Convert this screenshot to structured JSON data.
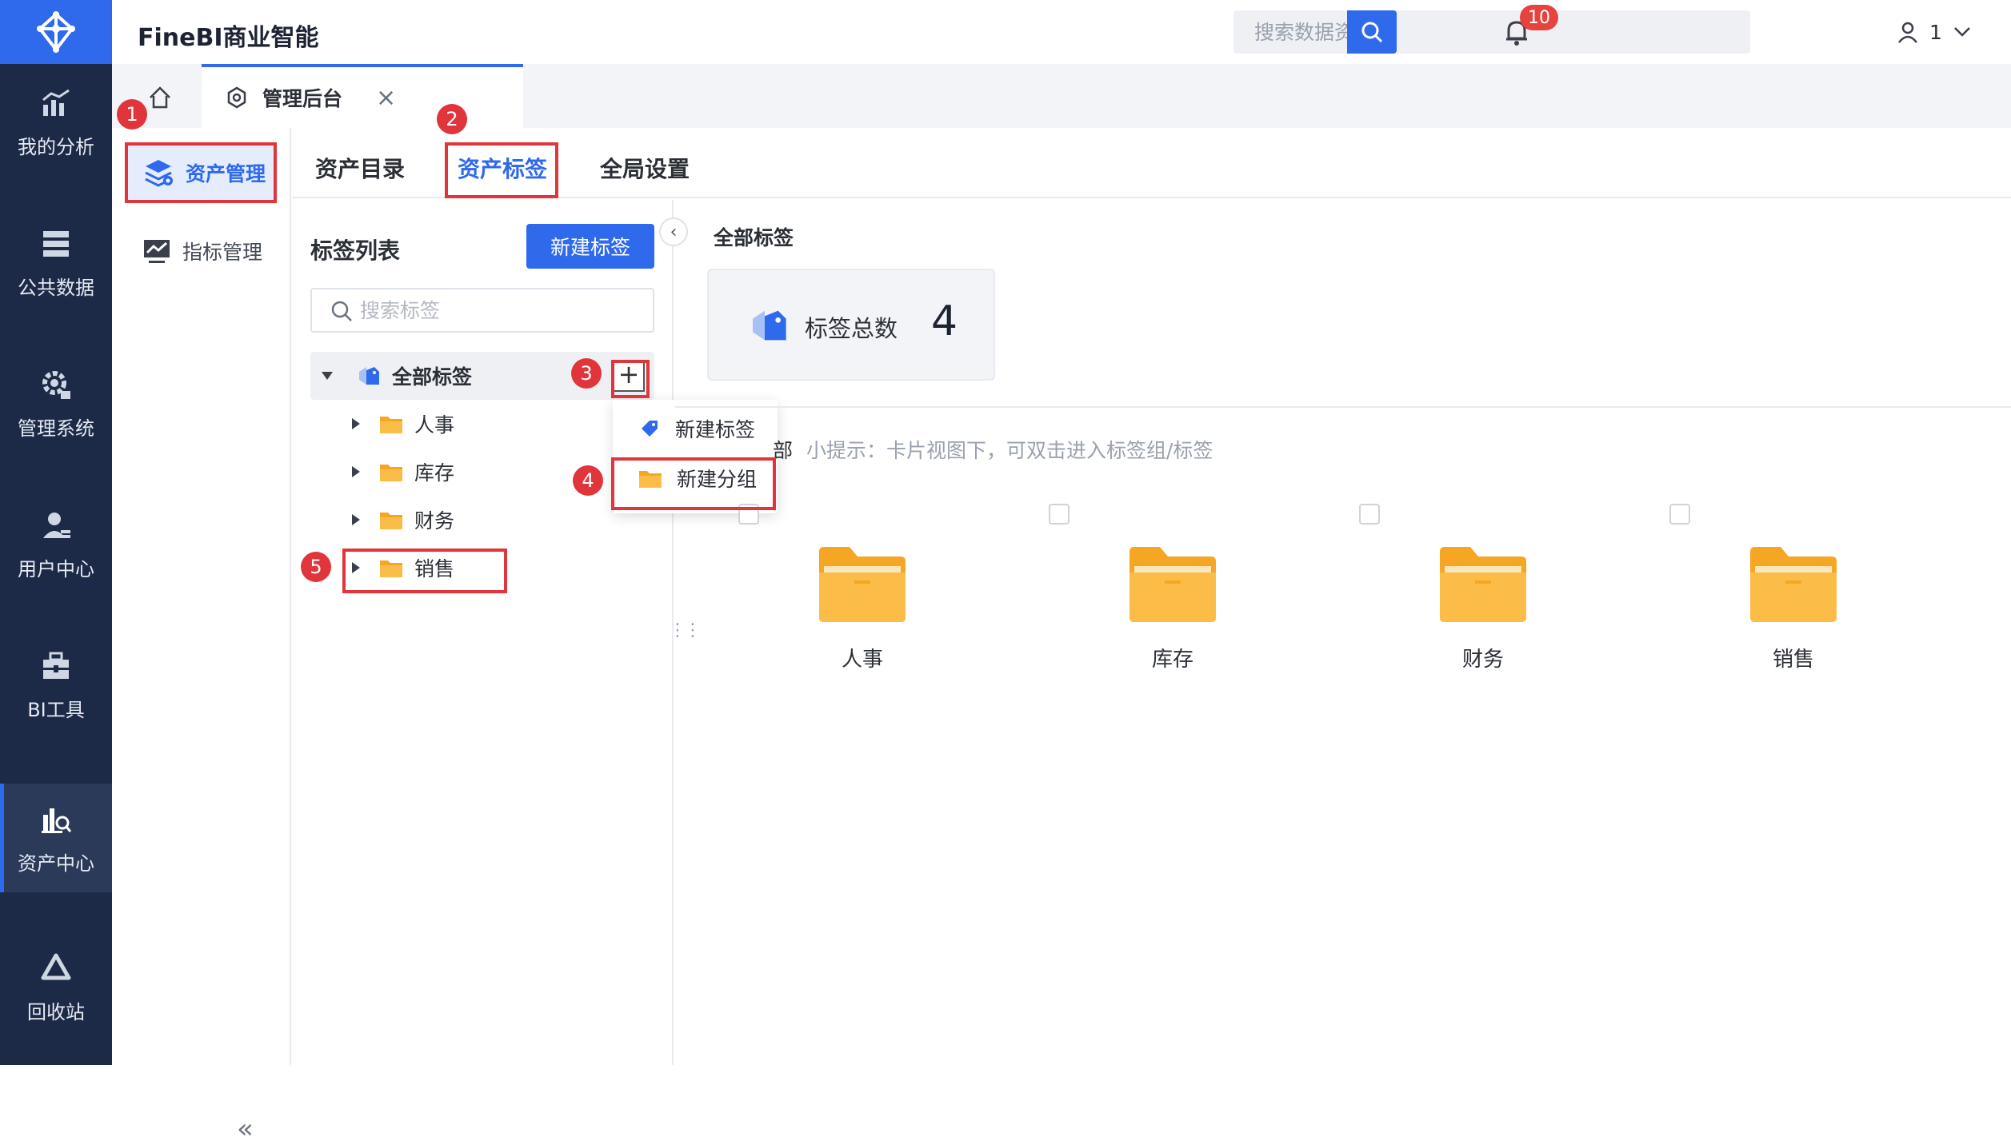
{
  "app": {
    "title": "FineBI商业智能"
  },
  "search": {
    "placeholder": "搜索数据资产"
  },
  "notifications": {
    "count": "10"
  },
  "user": {
    "name": "1"
  },
  "nav": {
    "items": [
      {
        "label": "我的分析",
        "icon": "chart-icon"
      },
      {
        "label": "公共数据",
        "icon": "database-icon"
      },
      {
        "label": "管理系统",
        "icon": "gear-icon"
      },
      {
        "label": "用户中心",
        "icon": "user-icon"
      },
      {
        "label": "BI工具",
        "icon": "toolbox-icon"
      },
      {
        "label": "资产中心",
        "icon": "asset-search-icon",
        "active": true
      },
      {
        "label": "回收站",
        "icon": "recycle-icon"
      }
    ]
  },
  "tabs": {
    "active": "管理后台"
  },
  "subnav": {
    "items": [
      {
        "label": "资产管理",
        "active": true
      },
      {
        "label": "指标管理"
      }
    ],
    "collapse": "«"
  },
  "content_tabs": [
    {
      "label": "资产目录"
    },
    {
      "label": "资产标签",
      "active": true
    },
    {
      "label": "全局设置"
    }
  ],
  "tag_panel": {
    "title": "标签列表",
    "new_button": "新建标签",
    "search_placeholder": "搜索标签",
    "root": "全部标签",
    "groups": [
      "人事",
      "库存",
      "财务",
      "销售"
    ]
  },
  "popup": {
    "items": [
      "新建标签",
      "新建分组"
    ]
  },
  "annotations": [
    "1",
    "2",
    "3",
    "4",
    "5"
  ],
  "main": {
    "title": "全部标签",
    "stat_label": "标签总数",
    "stat_value": "4",
    "crumb": "部",
    "hint": "小提示：卡片视图下，可双击进入标签组/标签",
    "cards": [
      "人事",
      "库存",
      "财务",
      "销售"
    ]
  },
  "colors": {
    "accent": "#2f69ec",
    "nav_bg": "#1c2a48",
    "annotation": "#e0353b",
    "folder": "#f5a623"
  }
}
